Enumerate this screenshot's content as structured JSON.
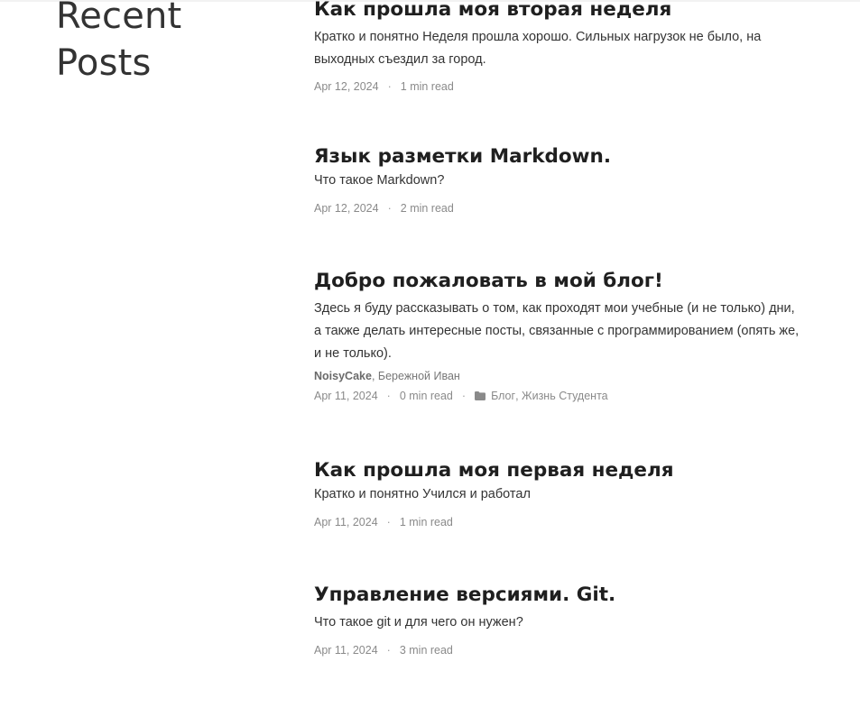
{
  "sidebar": {
    "title_line1": "Recent",
    "title_line2": "Posts"
  },
  "posts": [
    {
      "title": "Как прошла моя вторая неделя",
      "excerpt": "Кратко и понятно Неделя прошла хорошо. Сильных нагрузок не было, на выходных съездил за город.",
      "date": "Apr 12, 2024",
      "read_time": "1 min read"
    },
    {
      "title": "Язык разметки Markdown.",
      "excerpt": "Что такое Markdown?",
      "date": "Apr 12, 2024",
      "read_time": "2 min read"
    },
    {
      "title": "Добро пожаловать в мой блог!",
      "excerpt": "Здесь я буду рассказывать о том, как проходят мои учебные (и не только) дни, а также делать интересные посты, связанные с программированием (опять же, и не только).",
      "authors": [
        "NoisyCake",
        "Бережной Иван"
      ],
      "date": "Apr 11, 2024",
      "read_time": "0 min read",
      "categories": [
        "Блог",
        "Жизнь Студента"
      ],
      "category_icon": "folder-icon"
    },
    {
      "title": "Как прошла моя первая неделя",
      "excerpt": "Кратко и понятно Учился и работал",
      "date": "Apr 11, 2024",
      "read_time": "1 min read"
    },
    {
      "title": "Управление версиями. Git.",
      "excerpt": "Что такое git и для чего он нужен?",
      "date": "Apr 11, 2024",
      "read_time": "3 min read"
    }
  ],
  "separator": "·",
  "author_separator": ",",
  "category_separator": ","
}
